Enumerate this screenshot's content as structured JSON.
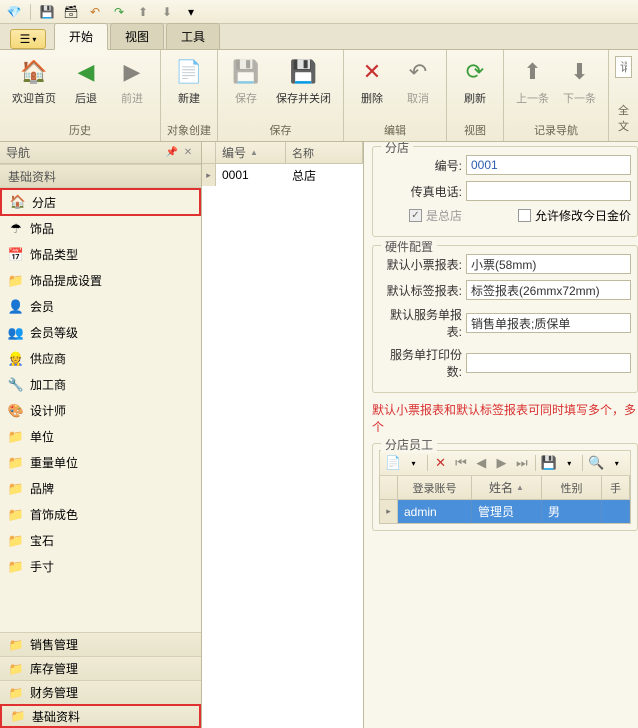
{
  "topIcons": [
    "diamond",
    "save",
    "save-close",
    "undo",
    "redo",
    "up",
    "down",
    "dropdown"
  ],
  "tabs": {
    "start": "开始",
    "view": "视图",
    "tools": "工具"
  },
  "ribbon": {
    "history": {
      "label": "历史",
      "home": "欢迎首页",
      "back": "后退",
      "forward": "前进"
    },
    "create": {
      "label": "对象创建",
      "new": "新建"
    },
    "save": {
      "label": "保存",
      "save": "保存",
      "saveClose": "保存并关闭"
    },
    "edit": {
      "label": "编辑",
      "delete": "删除",
      "cancel": "取消"
    },
    "viewg": {
      "label": "视图",
      "refresh": "刷新"
    },
    "recnav": {
      "label": "记录导航",
      "prev": "上一条",
      "next": "下一条"
    },
    "fulltext": {
      "label": "全文",
      "placeholder": "请输入关键字"
    }
  },
  "nav": {
    "title": "导航",
    "section": "基础资料",
    "items": [
      {
        "label": "分店",
        "icon": "🏠",
        "hl": true
      },
      {
        "label": "饰品",
        "icon": "☂"
      },
      {
        "label": "饰品类型",
        "icon": "📅"
      },
      {
        "label": "饰品提成设置",
        "icon": "📁"
      },
      {
        "label": "会员",
        "icon": "👤"
      },
      {
        "label": "会员等级",
        "icon": "👥"
      },
      {
        "label": "供应商",
        "icon": "👷"
      },
      {
        "label": "加工商",
        "icon": "🔧"
      },
      {
        "label": "设计师",
        "icon": "🎨"
      },
      {
        "label": "单位",
        "icon": "📁"
      },
      {
        "label": "重量单位",
        "icon": "📁"
      },
      {
        "label": "品牌",
        "icon": "📁"
      },
      {
        "label": "首饰成色",
        "icon": "📁"
      },
      {
        "label": "宝石",
        "icon": "📁"
      },
      {
        "label": "手寸",
        "icon": "📁"
      }
    ],
    "bottom": [
      {
        "label": "销售管理",
        "hl": false
      },
      {
        "label": "库存管理",
        "hl": false
      },
      {
        "label": "财务管理",
        "hl": false
      },
      {
        "label": "基础资料",
        "hl": true
      }
    ]
  },
  "midGrid": {
    "cols": {
      "code": "编号",
      "name": "名称"
    },
    "row": {
      "code": "0001",
      "name": "总店"
    }
  },
  "detail": {
    "storeSection": "分店",
    "codeLabel": "编号:",
    "codeValue": "0001",
    "faxLabel": "传真电话:",
    "faxValue": "",
    "isMain": "是总店",
    "allowEdit": "允许修改今日金价",
    "hwSection": "硬件配置",
    "receiptLabel": "默认小票报表:",
    "receiptValue": "小票(58mm)",
    "tagLabel": "默认标签报表:",
    "tagValue": "标签报表(26mmx72mm)",
    "serviceLabel": "默认服务单报表:",
    "serviceValue": "销售单报表;质保单",
    "copiesLabel": "服务单打印份数:",
    "copiesValue": "",
    "note": "默认小票报表和默认标签报表可同时填写多个，多个",
    "staffSection": "分店员工",
    "staffCols": {
      "account": "登录账号",
      "name": "姓名",
      "gender": "性别",
      "mobile": "手"
    },
    "staffRow": {
      "account": "admin",
      "name": "管理员",
      "gender": "男"
    }
  }
}
